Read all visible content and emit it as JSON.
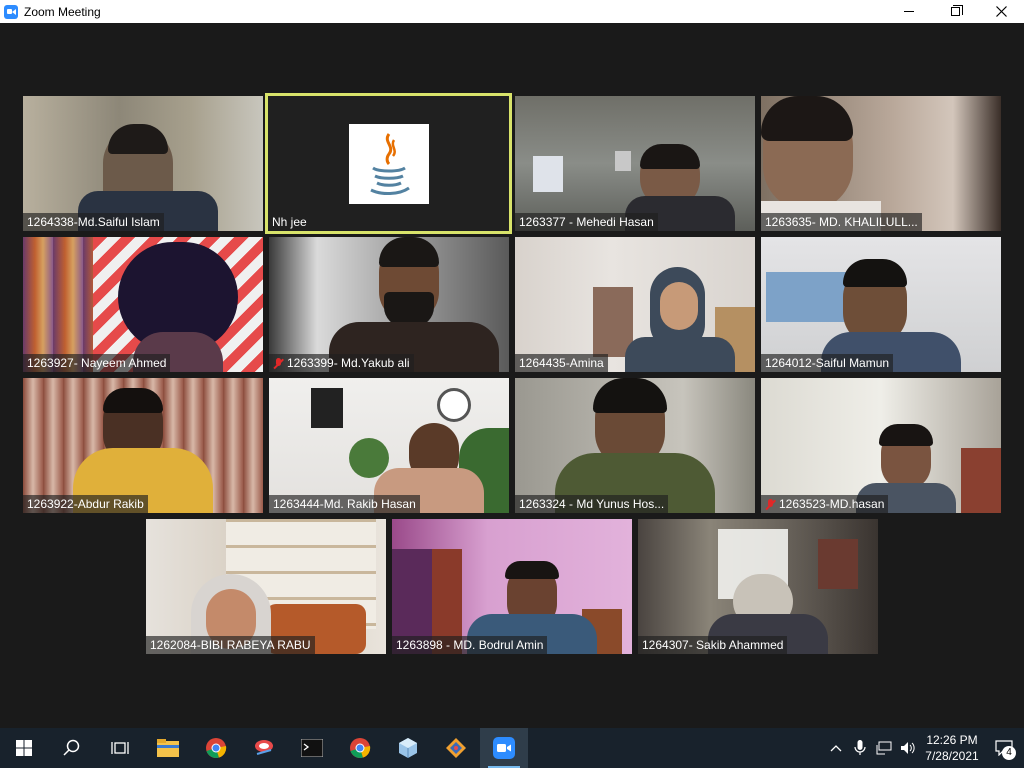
{
  "window": {
    "title": "Zoom Meeting"
  },
  "participants": [
    {
      "name": "1264338-Md.Saiful Islam",
      "muted": false
    },
    {
      "name": "Nh jee",
      "muted": false
    },
    {
      "name": "1263377 - Mehedi Hasan",
      "muted": false
    },
    {
      "name": "1263635- MD. KHALILULL...",
      "muted": false
    },
    {
      "name": "1263927- Nayeem Ahmed",
      "muted": false
    },
    {
      "name": "1263399- Md.Yakub ali",
      "muted": true
    },
    {
      "name": "1264435-Amina",
      "muted": false
    },
    {
      "name": "1264012-Saiful Mamun",
      "muted": false
    },
    {
      "name": "1263922-Abdur Rakib",
      "muted": false
    },
    {
      "name": "1263444-Md. Rakib Hasan",
      "muted": false
    },
    {
      "name": "1263324 - Md Yunus Hos...",
      "muted": false
    },
    {
      "name": "1263523-MD.hasan",
      "muted": true
    },
    {
      "name": "1262084-BIBI RABEYA RABU",
      "muted": false
    },
    {
      "name": "1263898 - MD. Bodrul Amin",
      "muted": false
    },
    {
      "name": "1264307- Sakib  Ahammed",
      "muted": false
    }
  ],
  "active_speaker": "Nh jee",
  "taskbar": {
    "time": "12:26 PM",
    "date": "7/28/2021",
    "notification_count": "4"
  }
}
